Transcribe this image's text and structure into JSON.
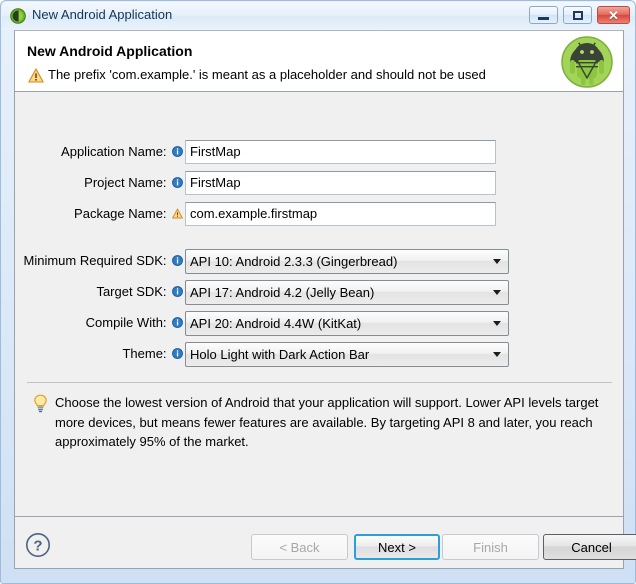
{
  "window": {
    "title": "New Android Application",
    "icon": "android-green-icon",
    "controls": {
      "minimize": "minimize-icon",
      "maximize": "maximize-icon",
      "close": "close-icon",
      "close_glyph": "✕"
    }
  },
  "header": {
    "title": "New Android Application",
    "warning_icon": "warning-triangle-icon",
    "warning_text": "The prefix 'com.example.' is meant as a placeholder and should not be used",
    "logo": "android-robot-logo"
  },
  "form": {
    "fields": [
      {
        "label": "Application Name:",
        "icon": "info-icon",
        "value": "FirstMap",
        "type": "text"
      },
      {
        "label": "Project Name:",
        "icon": "info-icon",
        "value": "FirstMap",
        "type": "text"
      },
      {
        "label": "Package Name:",
        "icon": "warning-icon",
        "value": "com.example.firstmap",
        "type": "text"
      }
    ],
    "dropdowns": [
      {
        "label": "Minimum Required SDK:",
        "icon": "info-icon",
        "value": "API 10: Android 2.3.3 (Gingerbread)"
      },
      {
        "label": "Target SDK:",
        "icon": "info-icon",
        "value": "API 17: Android 4.2 (Jelly Bean)"
      },
      {
        "label": "Compile With:",
        "icon": "info-icon",
        "value": "API 20: Android 4.4W (KitKat)"
      },
      {
        "label": "Theme:",
        "icon": "info-icon",
        "value": "Holo Light with Dark Action Bar"
      }
    ]
  },
  "hint": {
    "icon": "lightbulb-icon",
    "text": "Choose the lowest version of Android that your application will support. Lower API levels target more devices, but means fewer features are available. By targeting API 8 and later, you reach approximately 95% of the market."
  },
  "footer": {
    "help_icon": "help-question-icon",
    "buttons": [
      {
        "label": "< Back",
        "state": "disabled"
      },
      {
        "label": "Next >",
        "state": "default-focused"
      },
      {
        "label": "Finish",
        "state": "disabled"
      },
      {
        "label": "Cancel",
        "state": "enabled"
      }
    ]
  },
  "colors": {
    "accent_blue": "#29a0da",
    "android_green": "#8cc63e",
    "warning_orange": "#f5a623",
    "info_blue": "#2d7dc4",
    "dialog_bg": "#f0f0f0",
    "frame_blue": "#cfe0f4"
  }
}
